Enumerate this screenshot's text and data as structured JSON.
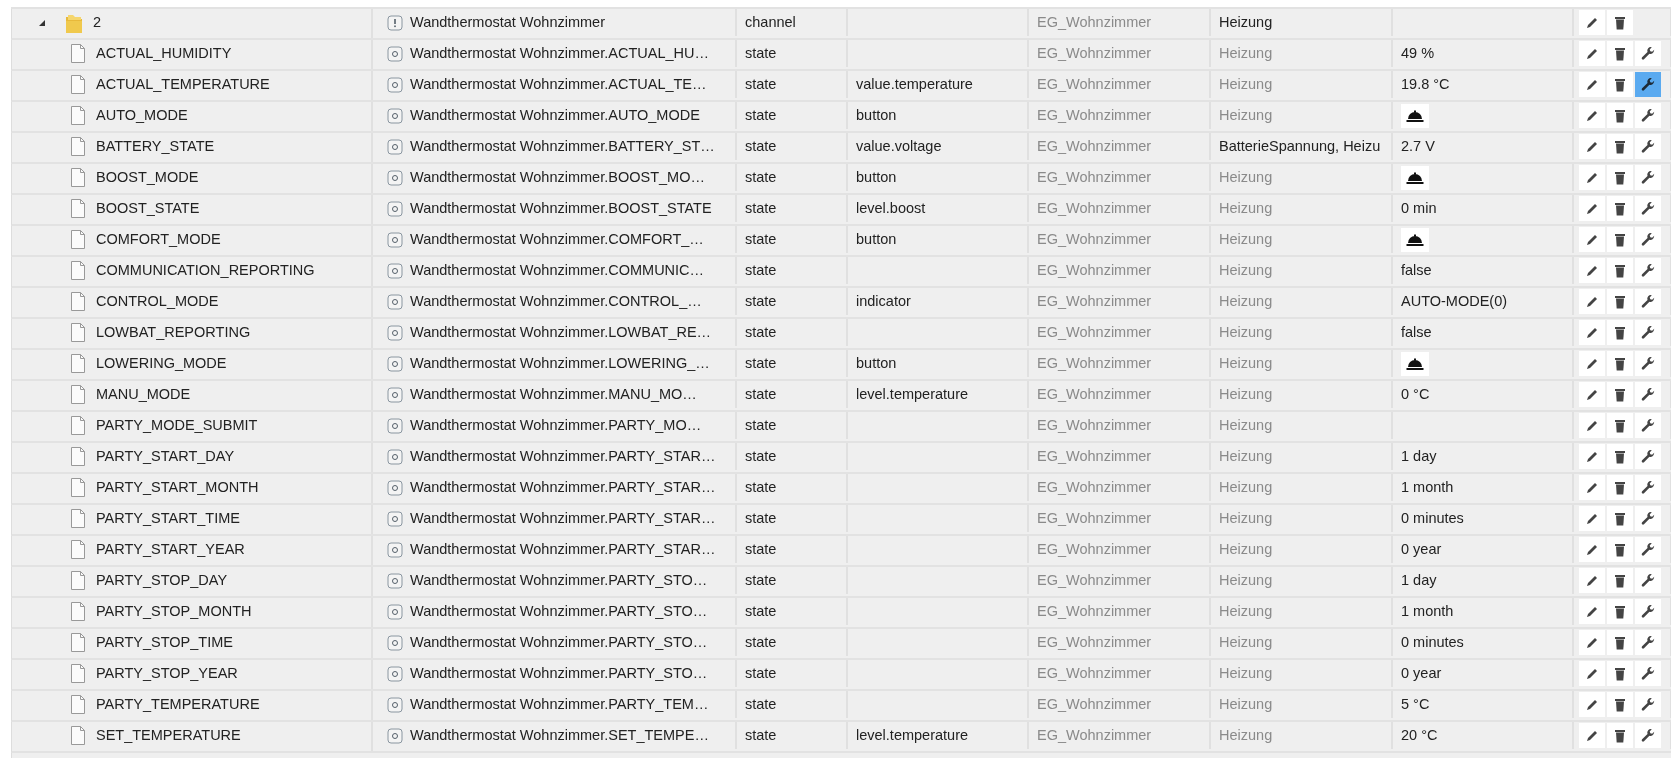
{
  "tree": {
    "items": [
      {
        "kind": "folder",
        "id": "2",
        "expanded": true,
        "name": "Wandthermostat Wohnzimmer",
        "type": "channel",
        "room": "EG_Wohnzimmer",
        "function": "Heizung",
        "function_inherited": false,
        "children": [
          {
            "kind": "file",
            "id": "ACTUAL_HUMIDITY",
            "name": "Wandthermostat Wohnzimmer.ACTUAL_HU…",
            "type": "state",
            "room": "EG_Wohnzimmer",
            "function": "Heizung",
            "function_inherited": true,
            "value": {
              "kind": "text",
              "text": "49 %"
            },
            "settings_active": false
          },
          {
            "kind": "file",
            "id": "ACTUAL_TEMPERATURE",
            "name": "Wandthermostat Wohnzimmer.ACTUAL_TE…",
            "type": "state",
            "role": "value.temperature",
            "room": "EG_Wohnzimmer",
            "function": "Heizung",
            "function_inherited": true,
            "value": {
              "kind": "text",
              "text": "19.8 °C"
            },
            "settings_active": true
          },
          {
            "kind": "file",
            "id": "AUTO_MODE",
            "name": "Wandthermostat Wohnzimmer.AUTO_MODE",
            "type": "state",
            "role": "button",
            "room": "EG_Wohnzimmer",
            "function": "Heizung",
            "function_inherited": true,
            "value": {
              "kind": "button"
            },
            "settings_active": false
          },
          {
            "kind": "file",
            "id": "BATTERY_STATE",
            "name": "Wandthermostat Wohnzimmer.BATTERY_ST…",
            "type": "state",
            "role": "value.voltage",
            "room": "EG_Wohnzimmer",
            "function": "BatterieSpannung, Heizu",
            "function_inherited": false,
            "value": {
              "kind": "text",
              "text": "2.7 V"
            },
            "settings_active": false
          },
          {
            "kind": "file",
            "id": "BOOST_MODE",
            "name": "Wandthermostat Wohnzimmer.BOOST_MO…",
            "type": "state",
            "role": "button",
            "room": "EG_Wohnzimmer",
            "function": "Heizung",
            "function_inherited": true,
            "value": {
              "kind": "button"
            },
            "settings_active": false
          },
          {
            "kind": "file",
            "id": "BOOST_STATE",
            "name": "Wandthermostat Wohnzimmer.BOOST_STATE",
            "type": "state",
            "role": "level.boost",
            "room": "EG_Wohnzimmer",
            "function": "Heizung",
            "function_inherited": true,
            "value": {
              "kind": "text",
              "text": "0 min"
            },
            "settings_active": false
          },
          {
            "kind": "file",
            "id": "COMFORT_MODE",
            "name": "Wandthermostat Wohnzimmer.COMFORT_…",
            "type": "state",
            "role": "button",
            "room": "EG_Wohnzimmer",
            "function": "Heizung",
            "function_inherited": true,
            "value": {
              "kind": "button"
            },
            "settings_active": false
          },
          {
            "kind": "file",
            "id": "COMMUNICATION_REPORTING",
            "name": "Wandthermostat Wohnzimmer.COMMUNIC…",
            "type": "state",
            "room": "EG_Wohnzimmer",
            "function": "Heizung",
            "function_inherited": true,
            "value": {
              "kind": "text",
              "text": "false"
            },
            "settings_active": false
          },
          {
            "kind": "file",
            "id": "CONTROL_MODE",
            "name": "Wandthermostat Wohnzimmer.CONTROL_…",
            "type": "state",
            "role": "indicator",
            "room": "EG_Wohnzimmer",
            "function": "Heizung",
            "function_inherited": true,
            "value": {
              "kind": "text",
              "text": "AUTO-MODE(0)"
            },
            "settings_active": false
          },
          {
            "kind": "file",
            "id": "LOWBAT_REPORTING",
            "name": "Wandthermostat Wohnzimmer.LOWBAT_RE…",
            "type": "state",
            "room": "EG_Wohnzimmer",
            "function": "Heizung",
            "function_inherited": true,
            "value": {
              "kind": "text",
              "text": "false"
            },
            "settings_active": false
          },
          {
            "kind": "file",
            "id": "LOWERING_MODE",
            "name": "Wandthermostat Wohnzimmer.LOWERING_…",
            "type": "state",
            "role": "button",
            "room": "EG_Wohnzimmer",
            "function": "Heizung",
            "function_inherited": true,
            "value": {
              "kind": "button"
            },
            "settings_active": false
          },
          {
            "kind": "file",
            "id": "MANU_MODE",
            "name": "Wandthermostat Wohnzimmer.MANU_MO…",
            "type": "state",
            "role": "level.temperature",
            "room": "EG_Wohnzimmer",
            "function": "Heizung",
            "function_inherited": true,
            "value": {
              "kind": "text",
              "text": "0 °C"
            },
            "settings_active": false
          },
          {
            "kind": "file",
            "id": "PARTY_MODE_SUBMIT",
            "name": "Wandthermostat Wohnzimmer.PARTY_MO…",
            "type": "state",
            "room": "EG_Wohnzimmer",
            "function": "Heizung",
            "function_inherited": true,
            "settings_active": false
          },
          {
            "kind": "file",
            "id": "PARTY_START_DAY",
            "name": "Wandthermostat Wohnzimmer.PARTY_STAR…",
            "type": "state",
            "room": "EG_Wohnzimmer",
            "function": "Heizung",
            "function_inherited": true,
            "value": {
              "kind": "text",
              "text": "1 day"
            },
            "settings_active": false
          },
          {
            "kind": "file",
            "id": "PARTY_START_MONTH",
            "name": "Wandthermostat Wohnzimmer.PARTY_STAR…",
            "type": "state",
            "room": "EG_Wohnzimmer",
            "function": "Heizung",
            "function_inherited": true,
            "value": {
              "kind": "text",
              "text": "1 month"
            },
            "settings_active": false
          },
          {
            "kind": "file",
            "id": "PARTY_START_TIME",
            "name": "Wandthermostat Wohnzimmer.PARTY_STAR…",
            "type": "state",
            "room": "EG_Wohnzimmer",
            "function": "Heizung",
            "function_inherited": true,
            "value": {
              "kind": "text",
              "text": "0 minutes"
            },
            "settings_active": false
          },
          {
            "kind": "file",
            "id": "PARTY_START_YEAR",
            "name": "Wandthermostat Wohnzimmer.PARTY_STAR…",
            "type": "state",
            "room": "EG_Wohnzimmer",
            "function": "Heizung",
            "function_inherited": true,
            "value": {
              "kind": "text",
              "text": "0 year"
            },
            "settings_active": false
          },
          {
            "kind": "file",
            "id": "PARTY_STOP_DAY",
            "name": "Wandthermostat Wohnzimmer.PARTY_STO…",
            "type": "state",
            "room": "EG_Wohnzimmer",
            "function": "Heizung",
            "function_inherited": true,
            "value": {
              "kind": "text",
              "text": "1 day"
            },
            "settings_active": false
          },
          {
            "kind": "file",
            "id": "PARTY_STOP_MONTH",
            "name": "Wandthermostat Wohnzimmer.PARTY_STO…",
            "type": "state",
            "room": "EG_Wohnzimmer",
            "function": "Heizung",
            "function_inherited": true,
            "value": {
              "kind": "text",
              "text": "1 month"
            },
            "settings_active": false
          },
          {
            "kind": "file",
            "id": "PARTY_STOP_TIME",
            "name": "Wandthermostat Wohnzimmer.PARTY_STO…",
            "type": "state",
            "room": "EG_Wohnzimmer",
            "function": "Heizung",
            "function_inherited": true,
            "value": {
              "kind": "text",
              "text": "0 minutes"
            },
            "settings_active": false
          },
          {
            "kind": "file",
            "id": "PARTY_STOP_YEAR",
            "name": "Wandthermostat Wohnzimmer.PARTY_STO…",
            "type": "state",
            "room": "EG_Wohnzimmer",
            "function": "Heizung",
            "function_inherited": true,
            "value": {
              "kind": "text",
              "text": "0 year"
            },
            "settings_active": false
          },
          {
            "kind": "file",
            "id": "PARTY_TEMPERATURE",
            "name": "Wandthermostat Wohnzimmer.PARTY_TEM…",
            "type": "state",
            "room": "EG_Wohnzimmer",
            "function": "Heizung",
            "function_inherited": true,
            "value": {
              "kind": "text",
              "text": "5 °C"
            },
            "settings_active": false
          },
          {
            "kind": "file",
            "id": "SET_TEMPERATURE",
            "name": "Wandthermostat Wohnzimmer.SET_TEMPE…",
            "type": "state",
            "role": "level.temperature",
            "room": "EG_Wohnzimmer",
            "function": "Heizung",
            "function_inherited": true,
            "value": {
              "kind": "text",
              "text": "20 °C"
            },
            "settings_active": false
          }
        ]
      }
    ]
  }
}
